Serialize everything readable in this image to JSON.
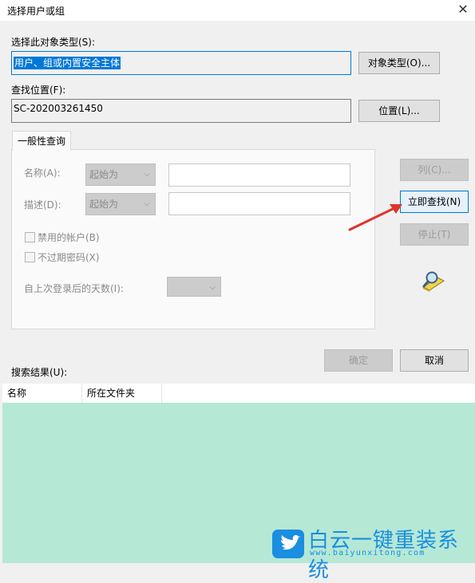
{
  "window": {
    "title": "选择用户或组",
    "close_glyph": "✕"
  },
  "object_type": {
    "label": "选择此对象类型(S):",
    "value": "用户、组或内置安全主体",
    "button": "对象类型(O)..."
  },
  "location": {
    "label": "查找位置(F):",
    "value": "SC-202003261450",
    "button": "位置(L)..."
  },
  "tab": {
    "label": "一般性查询"
  },
  "query": {
    "name_label": "名称(A):",
    "name_combo": "起始为",
    "desc_label": "描述(D):",
    "desc_combo": "起始为",
    "disabled_accounts": "禁用的帐户(B)",
    "non_expiring_pw": "不过期密码(X)",
    "days_label": "自上次登录后的天数(I):"
  },
  "side_buttons": {
    "columns": "列(C)...",
    "find_now": "立即查找(N)",
    "stop": "停止(T)"
  },
  "dialog_buttons": {
    "ok": "确定",
    "cancel": "取消"
  },
  "results": {
    "label": "搜索结果(U):",
    "columns": [
      "名称",
      "所在文件夹"
    ]
  },
  "watermark": {
    "title": "白云一键重装系统",
    "url": "www.baiyunxitong.com"
  },
  "colors": {
    "selection": "#0078d7",
    "results_bg": "#b5e8d5",
    "annotation_arrow": "#e0332b",
    "watermark": "#1a8ee0"
  }
}
